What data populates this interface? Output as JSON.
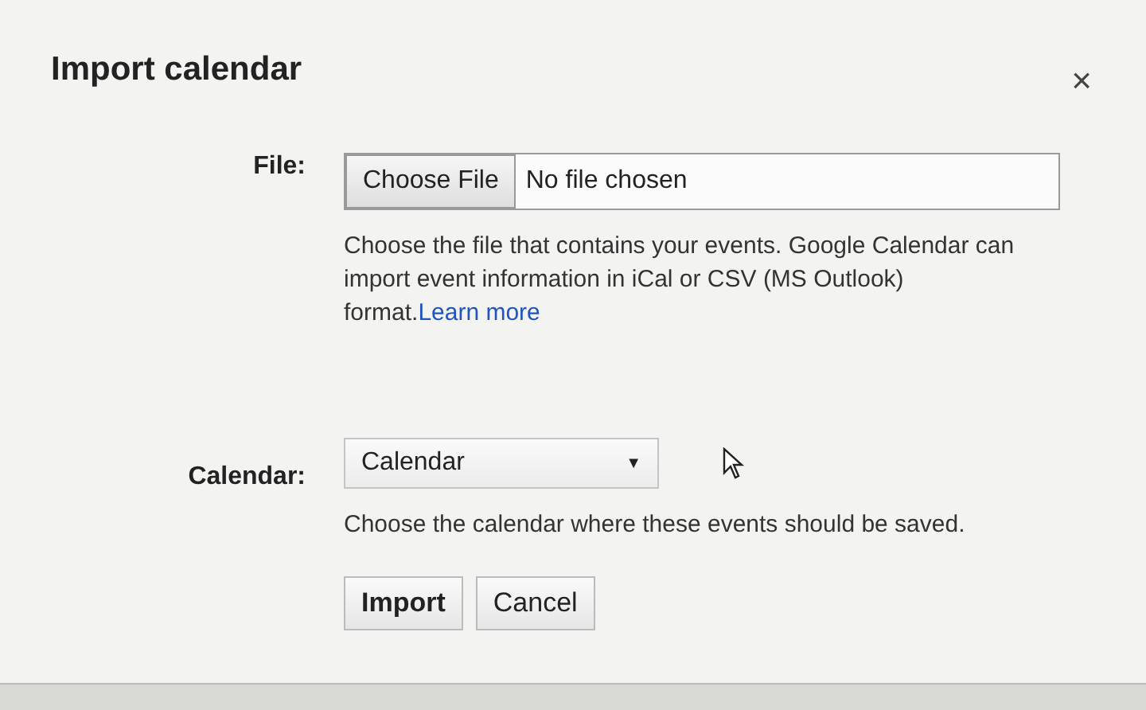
{
  "dialog": {
    "title": "Import calendar",
    "close": "×"
  },
  "file": {
    "label": "File:",
    "button": "Choose File",
    "status": "No file chosen",
    "help": "Choose the file that contains your events. Google Calendar can import event information in iCal or CSV (MS Outlook) format.",
    "link": "Learn more"
  },
  "calendar": {
    "label": "Calendar:",
    "value": "Calendar",
    "caret": "▼",
    "help": "Choose the calendar where these events should be saved."
  },
  "buttons": [
    {
      "label": "Import",
      "kind": "primary"
    },
    {
      "label": "Cancel",
      "kind": "secondary"
    }
  ]
}
